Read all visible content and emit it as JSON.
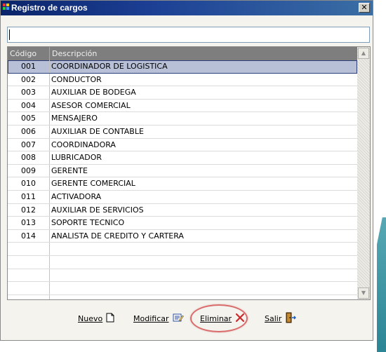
{
  "window": {
    "title": "Registro de cargos",
    "close_label": "✕"
  },
  "search": {
    "value": "",
    "placeholder": ""
  },
  "table": {
    "columns": [
      "Código",
      "Descripción"
    ],
    "selected_row": "001",
    "rows": [
      {
        "code": "001",
        "description": "COORDINADOR DE LOGISTICA"
      },
      {
        "code": "002",
        "description": "CONDUCTOR"
      },
      {
        "code": "003",
        "description": "AUXILIAR DE BODEGA"
      },
      {
        "code": "004",
        "description": "ASESOR COMERCIAL"
      },
      {
        "code": "005",
        "description": "MENSAJERO"
      },
      {
        "code": "006",
        "description": "AUXILIAR DE CONTABLE"
      },
      {
        "code": "007",
        "description": "COORDINADORA"
      },
      {
        "code": "008",
        "description": "LUBRICADOR"
      },
      {
        "code": "009",
        "description": "GERENTE"
      },
      {
        "code": "010",
        "description": "GERENTE COMERCIAL"
      },
      {
        "code": "011",
        "description": "ACTIVADORA"
      },
      {
        "code": "012",
        "description": "AUXILIAR DE SERVICIOS"
      },
      {
        "code": "013",
        "description": "SOPORTE TECNICO"
      },
      {
        "code": "014",
        "description": "ANALISTA DE CREDITO Y CARTERA"
      },
      {
        "code": "",
        "description": ""
      },
      {
        "code": "",
        "description": ""
      },
      {
        "code": "",
        "description": ""
      },
      {
        "code": "",
        "description": ""
      },
      {
        "code": "",
        "description": ""
      }
    ]
  },
  "toolbar": {
    "nuevo_label": "Nuevo",
    "modificar_label": "Modificar",
    "eliminar_label": "Eliminar",
    "salir_label": "Salir",
    "icons": {
      "nuevo": "new-document-icon",
      "modificar": "edit-record-icon",
      "eliminar": "delete-x-icon",
      "salir": "exit-door-icon"
    }
  },
  "colors": {
    "titlebar": "#0a246a",
    "header": "#7e7e7e",
    "selected_row": "#b7c0d6",
    "eliminar_highlight": "#d96b6b",
    "delete_icon": "#cc2a2a"
  }
}
